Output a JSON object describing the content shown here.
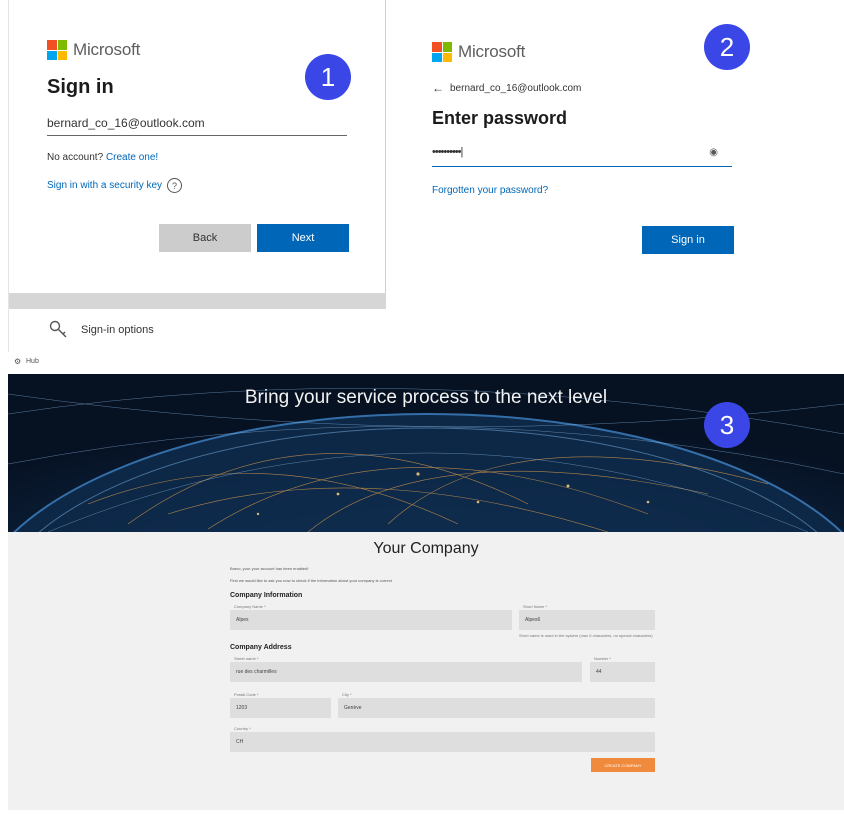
{
  "panel1": {
    "brand": "Microsoft",
    "step": "1",
    "title": "Sign in",
    "email_value": "bernard_co_16@outlook.com",
    "no_account": "No account?",
    "create_link": "Create one!",
    "security_key_link": "Sign in with a security key",
    "back_label": "Back",
    "next_label": "Next",
    "signin_options": "Sign-in options"
  },
  "panel2": {
    "brand": "Microsoft",
    "step": "2",
    "account": "bernard_co_16@outlook.com",
    "title": "Enter password",
    "password_mask": "••••••••••|",
    "forgot_link": "Forgotten your password?",
    "signin_label": "Sign in"
  },
  "panel3": {
    "logo_text": "Hub",
    "step": "3",
    "hero_title": "Bring your service process to the next level",
    "page_title": "Your Company",
    "intro_1": "Bravo, your your account has been enabled!",
    "intro_2": "First we would like to ask you now to check if the information about your company is correct",
    "section_info": "Company Information",
    "company_name_label": "Company Name *",
    "company_name_value": "Alpes",
    "short_name_label": "Short Name *",
    "short_name_value": "Alpes6",
    "short_name_hint": "Short name is used in the system (max 5 characters, no special characters)",
    "section_address": "Company Address",
    "street_label": "Street name *",
    "street_value": "rue des charmilles",
    "number_label": "Number *",
    "number_value": "44",
    "postcode_label": "Postal Code *",
    "postcode_value": "1203",
    "city_label": "City *",
    "city_value": "Genève",
    "country_label": "Country *",
    "country_value": "CH",
    "submit_label": "CREATE COMPANY"
  },
  "colors": {
    "ms_red": "#f25022",
    "ms_green": "#7fba00",
    "ms_blue": "#00a4ef",
    "ms_yellow": "#ffb900",
    "ms_button": "#0067b8",
    "step_badge": "#3b46e6",
    "submit_orange": "#f08a3c"
  }
}
